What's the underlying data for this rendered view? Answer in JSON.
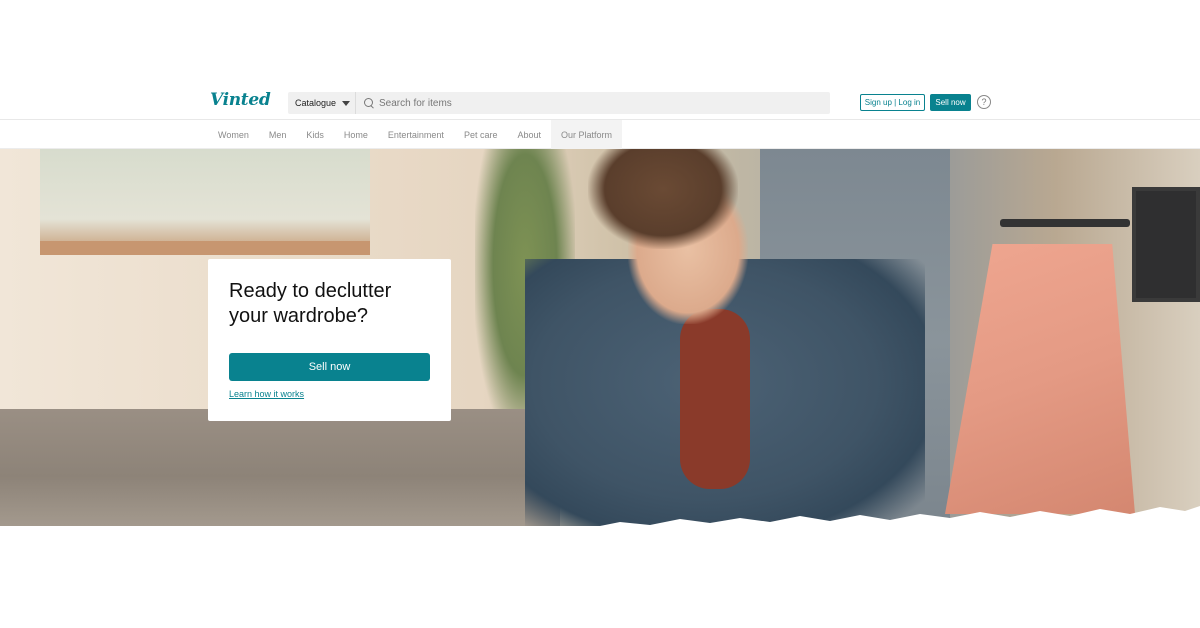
{
  "brand": {
    "logo_text": "Vinted",
    "accent_color": "#09828f"
  },
  "header": {
    "catalogue_label": "Catalogue",
    "search_placeholder": "Search for items",
    "signup_label": "Sign up | Log in",
    "sell_label": "Sell now",
    "help_glyph": "?"
  },
  "nav": {
    "items": [
      "Women",
      "Men",
      "Kids",
      "Home",
      "Entertainment",
      "Pet care",
      "About",
      "Our Platform"
    ],
    "active_index": 7
  },
  "hero": {
    "title": "Ready to declutter your wardrobe?",
    "cta_label": "Sell now",
    "link_label": "Learn how it works"
  },
  "icons": {
    "search": "search-icon",
    "catalogue_caret": "caret-down-icon",
    "help": "question-mark-icon"
  }
}
